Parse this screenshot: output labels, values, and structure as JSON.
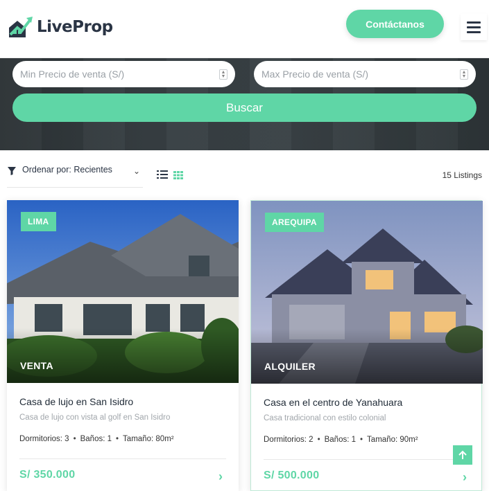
{
  "header": {
    "logo_text": "LiveProp",
    "contact_label": "Contáctanos"
  },
  "search": {
    "min_price_placeholder": "Min Precio de venta  (S/)",
    "max_price_placeholder": "Max Precio de venta  (S/)",
    "search_label": "Buscar"
  },
  "toolbar": {
    "sort_label": "Ordenar por: Recientes",
    "listings_count": "15 Listings"
  },
  "listings": [
    {
      "city": "LIMA",
      "type": "VENTA",
      "title": "Casa de lujo en San Isidro",
      "subtitle": "Casa de lujo con vista al golf en San Isidro",
      "bedrooms": "Dormitorios: 3",
      "bathrooms": "Baños: 1",
      "size": "Tamaño: 80m²",
      "price": "S/ 350.000"
    },
    {
      "city": "AREQUIPA",
      "type": "ALQUILER",
      "title": "Casa en el centro de Yanahuara",
      "subtitle": "Casa tradicional con estilo colonial",
      "bedrooms": "Dormitorios: 2",
      "bathrooms": "Baños: 1",
      "size": "Tamaño: 90m²",
      "price": "S/ 500.000"
    }
  ],
  "colors": {
    "accent": "#5fd6a6",
    "dark_text": "#2a3444"
  },
  "icons": [
    "logo-house-icon",
    "hamburger-menu-icon",
    "filter-icon",
    "chevron-down-icon",
    "list-view-icon",
    "grid-view-icon",
    "chevron-right-icon",
    "arrow-up-icon"
  ]
}
